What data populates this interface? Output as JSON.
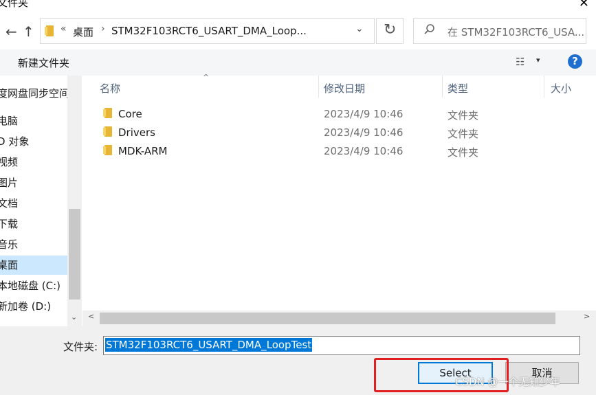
{
  "window": {
    "title": "文件夹",
    "close_glyph": "✕"
  },
  "nav": {
    "back_glyph": "←",
    "up_glyph": "↑",
    "breadcrumb_prefix": "«",
    "breadcrumb": [
      "桌面",
      "STM32F103RCT6_USART_DMA_Loop..."
    ],
    "breadcrumb_sep": "›",
    "dropdown_glyph": "⌄",
    "refresh_glyph": "↻",
    "search_placeholder": "在 STM32F103RCT6_USA..."
  },
  "toolbar": {
    "new_folder_label": "新建文件夹",
    "view_glyph": "☷",
    "dropdown_glyph": "▾",
    "help_glyph": "?"
  },
  "sidebar": {
    "items": [
      {
        "label": "度网盘同步空间",
        "selected": false
      },
      {
        "label": "电脑",
        "selected": false
      },
      {
        "label": "D 对象",
        "selected": false
      },
      {
        "label": "视频",
        "selected": false
      },
      {
        "label": "图片",
        "selected": false
      },
      {
        "label": "文档",
        "selected": false
      },
      {
        "label": "下载",
        "selected": false
      },
      {
        "label": "音乐",
        "selected": false
      },
      {
        "label": "桌面",
        "selected": true
      },
      {
        "label": "本地磁盘 (C:)",
        "selected": false
      },
      {
        "label": "新加卷 (D:)",
        "selected": false
      }
    ],
    "scroll_down_glyph": "⌄"
  },
  "file_list": {
    "columns": [
      "名称",
      "修改日期",
      "类型",
      "大小"
    ],
    "sort_glyph": "^",
    "rows": [
      {
        "name": "Core",
        "modified": "2023/4/9 10:46",
        "type": "文件夹"
      },
      {
        "name": "Drivers",
        "modified": "2023/4/9 10:46",
        "type": "文件夹"
      },
      {
        "name": "MDK-ARM",
        "modified": "2023/4/9 10:46",
        "type": "文件夹"
      }
    ],
    "scroll_left_glyph": "<",
    "scroll_right_glyph": ">"
  },
  "footer": {
    "folder_label": "文件夹:",
    "folder_value": "STM32F103RCT6_USART_DMA_LoopTest",
    "select_label": "Select",
    "cancel_label": "取消",
    "watermark": "CSDN @一个无知少年"
  },
  "colors": {
    "accent": "#0078d7",
    "selected_bg": "#cce8ff",
    "highlight_box": "#e02020",
    "folder": "#e8b636"
  }
}
